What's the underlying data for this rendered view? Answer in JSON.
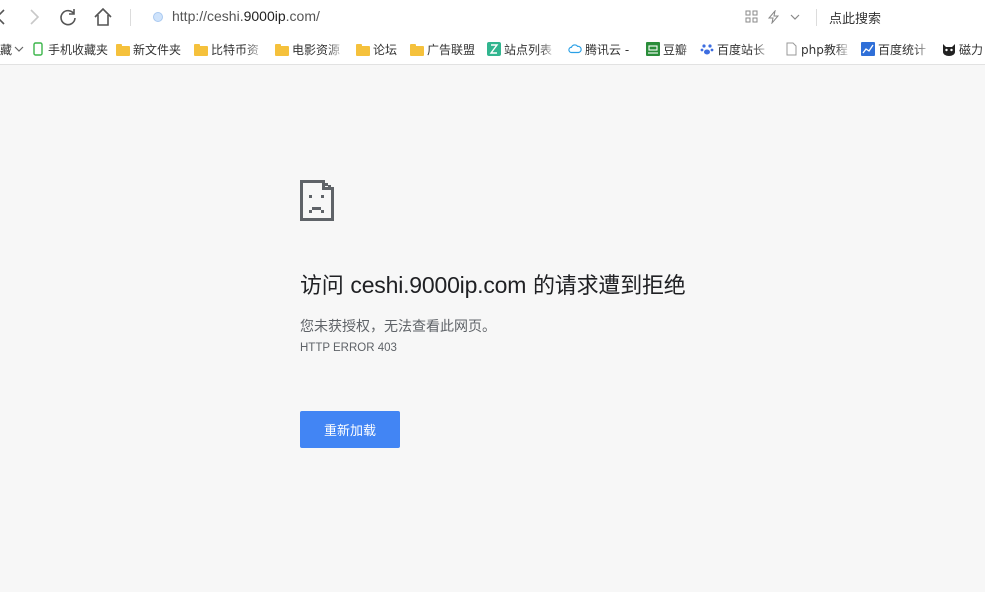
{
  "address_bar": {
    "url_prefix": "http://ceshi.",
    "url_host": "9000ip",
    "url_suffix": ".com/",
    "search_placeholder": "点此搜索"
  },
  "bookmarks": [
    {
      "label": "藏",
      "icon": "dropdown"
    },
    {
      "label": "手机收藏夹",
      "icon": "phone-icon"
    },
    {
      "label": "新文件夹",
      "icon": "folder-icon"
    },
    {
      "label": "比特币资",
      "icon": "folder-icon"
    },
    {
      "label": "电影资源",
      "icon": "folder-icon"
    },
    {
      "label": "论坛",
      "icon": "folder-icon"
    },
    {
      "label": "广告联盟",
      "icon": "folder-icon"
    },
    {
      "label": "站点列表",
      "icon": "site-list-icon"
    },
    {
      "label": "腾讯云 -",
      "icon": "cloud-icon"
    },
    {
      "label": "豆瓣",
      "icon": "douban-icon"
    },
    {
      "label": "百度站长",
      "icon": "baidu-paw-icon"
    },
    {
      "label": "php教程",
      "icon": "page-icon"
    },
    {
      "label": "百度统计",
      "icon": "stats-icon"
    },
    {
      "label": "磁力",
      "icon": "cat-icon"
    }
  ],
  "error": {
    "title_prefix": "访问 ",
    "title_domain": "ceshi.9000ip.com",
    "title_suffix": " 的请求遭到拒绝",
    "description": "您未获授权，无法查看此网页。",
    "code": "HTTP ERROR 403",
    "reload_label": "重新加载"
  },
  "colors": {
    "accent": "#4285f4",
    "background": "#f7f7f7"
  }
}
